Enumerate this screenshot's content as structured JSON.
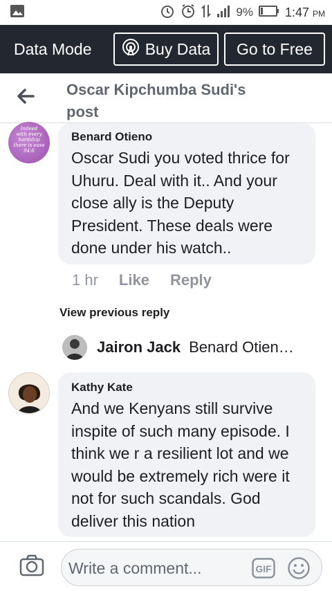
{
  "status_bar": {
    "battery": "9%",
    "time": "1:47",
    "ampm": "PM",
    "icons": [
      "image-icon",
      "alarm-icon",
      "data-arrows-icon",
      "signal-icon",
      "battery-icon"
    ]
  },
  "data_bar": {
    "mode_label": "Data Mode",
    "buy_label": "Buy Data",
    "free_label": "Go to Free"
  },
  "header": {
    "title_line1": "Oscar Kipchumba Sudi's",
    "title_line2": "post"
  },
  "comments": [
    {
      "author": "Benard Otieno",
      "avatar_text": [
        "Indeed",
        "with every",
        "hardship",
        "there is ease",
        "94:6"
      ],
      "lines": [
        "Oscar Sudi you voted thrice for",
        "Uhuru. Deal with it.. And your",
        "close ally is the Deputy",
        "President. These deals were",
        "done under his watch.."
      ],
      "time": "1 hr",
      "like": "Like",
      "reply": "Reply"
    },
    {
      "author": "Kathy Kate",
      "lines": [
        "And we Kenyans still survive",
        "inspite of such many episode. I",
        "think we r a resilient lot and we",
        "would be extremely rich were it",
        "not for such scandals. God",
        "deliver this nation"
      ]
    }
  ],
  "view_previous": "View previous reply",
  "reply_preview": {
    "name": "Jairon Jack",
    "snippet": "Benard Otien…"
  },
  "composer": {
    "placeholder": "Write a comment..."
  },
  "colors": {
    "data_bar_bg": "#23272f",
    "bubble_bg": "#f0f2f5",
    "meta_gray": "#90949c",
    "header_gray": "#606770"
  }
}
